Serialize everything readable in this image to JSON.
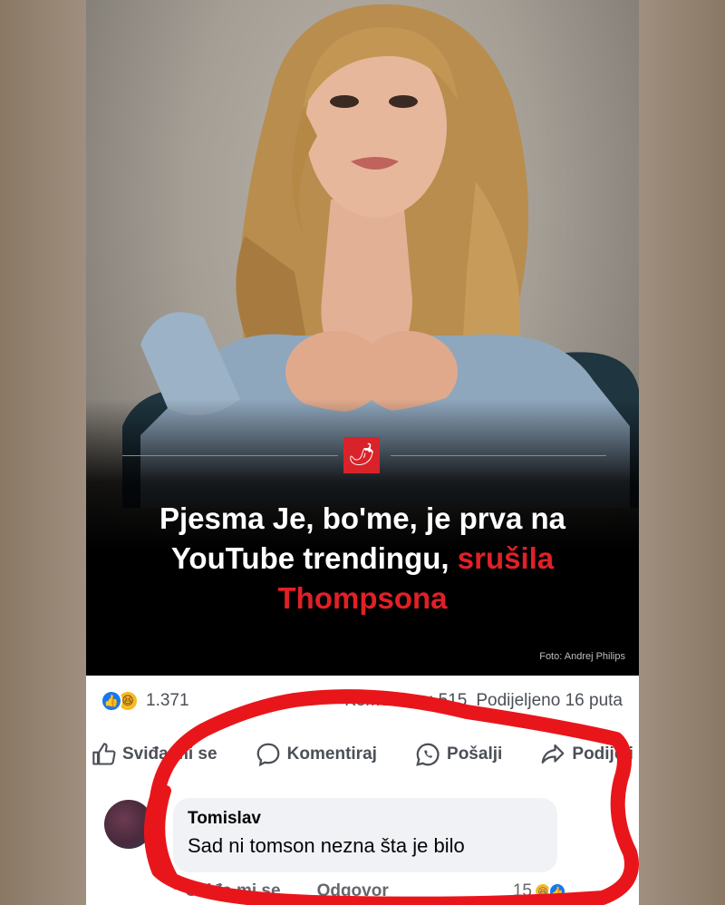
{
  "post": {
    "brand_icon": "chili-pepper-icon",
    "headline_white": "Pjesma Je, bo'me, je prva na YouTube trendingu, ",
    "headline_red": "srušila Thompsona",
    "photo_credit": "Foto: Andrej Philips"
  },
  "stats": {
    "reaction_count": "1.371",
    "comments": "Komentara: 515",
    "shares": "Podijeljeno 16 puta"
  },
  "actions": {
    "like": "Sviđa mi se",
    "comment": "Komentiraj",
    "send": "Pošalji",
    "share": "Podijeli"
  },
  "comment": {
    "author": "Tomislav",
    "text": "Sad ni tomson nezna šta je bilo",
    "like_label": "Sviđa mi se",
    "reply_label": "Odgovor",
    "reaction_count": "15"
  },
  "colors": {
    "brand_red": "#d9232a",
    "headline_red": "#e02027",
    "facebook_blue": "#1877f2",
    "haha_yellow": "#f7b928",
    "scribble_red": "#e8161b"
  }
}
